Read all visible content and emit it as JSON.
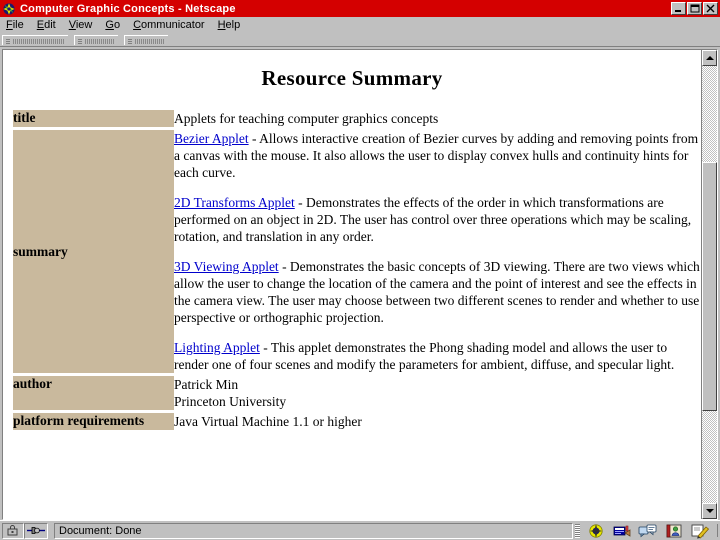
{
  "window": {
    "title": "Computer Graphic Concepts - Netscape",
    "app_icon": "netscape-logo-icon",
    "buttons": {
      "minimize": "_",
      "maximize": "❐",
      "close": "✕"
    }
  },
  "menubar": {
    "items": [
      {
        "label": "File",
        "accel": "F"
      },
      {
        "label": "Edit",
        "accel": "E"
      },
      {
        "label": "View",
        "accel": "V"
      },
      {
        "label": "Go",
        "accel": "G"
      },
      {
        "label": "Communicator",
        "accel": "C"
      },
      {
        "label": "Help",
        "accel": "H"
      }
    ]
  },
  "page": {
    "heading": "Resource Summary",
    "rows": [
      {
        "label": "title",
        "kind": "simple",
        "text": "Applets for teaching computer graphics concepts"
      },
      {
        "label": "summary",
        "kind": "paragraphs",
        "paragraphs": [
          {
            "link": "Bezier Applet",
            "text": " - Allows interactive creation of Bezier curves by adding and removing points from a canvas with the mouse. It also allows the user to display convex hulls and continuity hints for each curve."
          },
          {
            "link": "2D Transforms Applet",
            "text": " - Demonstrates the effects of the order in which transformations are performed on an object in 2D. The user has control over three operations which may be scaling, rotation, and translation in any order."
          },
          {
            "link": "3D Viewing Applet",
            "text": " - Demonstrates the basic concepts of 3D viewing. There are two views which allow the user to change the location of the camera and the point of interest and see the effects in the camera view. The user may choose between two different scenes to render and whether to use perspective or orthographic projection."
          },
          {
            "link": "Lighting Applet",
            "text": " - This applet demonstrates the Phong shading model and allows the user to render one of four scenes and modify the parameters for ambient, diffuse, and specular light."
          }
        ]
      },
      {
        "label": "author",
        "kind": "lines",
        "lines": [
          "Patrick Min",
          "Princeton University"
        ]
      },
      {
        "label": "platform requirements",
        "kind": "simple",
        "text": "Java Virtual Machine 1.1 or higher"
      }
    ]
  },
  "statusbar": {
    "message": "Document: Done",
    "lock_icon": "padlock-icon",
    "connection_icon": "connection-icon",
    "component_icons": [
      "navigator-icon",
      "mailbox-icon",
      "newsgroups-icon",
      "address-book-icon",
      "composer-icon"
    ]
  },
  "scrollbar": {
    "up_arrow": "scroll-up-arrow-icon",
    "down_arrow": "scroll-down-arrow-icon"
  },
  "colors": {
    "titlebar": "#d40000",
    "label_cell": "#c9b99d",
    "link": "#0000cc",
    "chrome": "#c0c0c0"
  }
}
